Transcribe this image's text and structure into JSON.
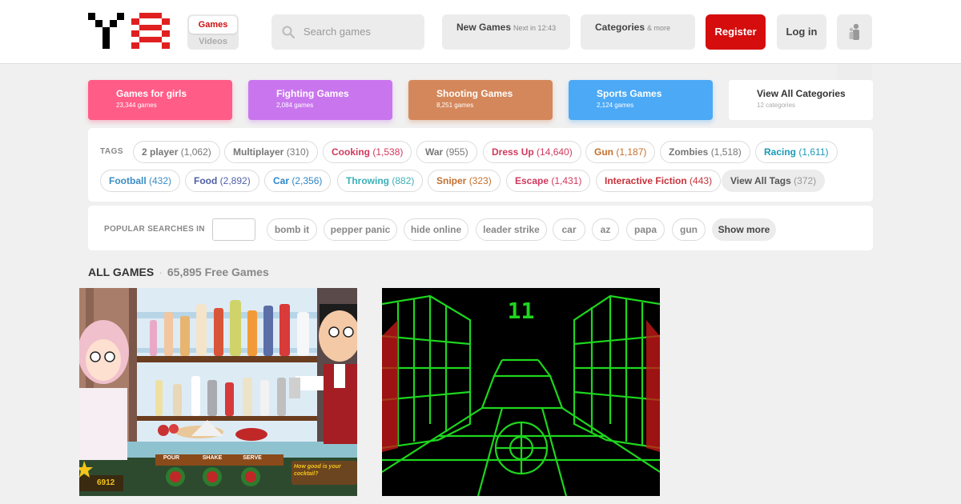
{
  "header": {
    "toggle": {
      "games": "Games",
      "videos": "Videos"
    },
    "search": {
      "placeholder": "Search games"
    },
    "new_games": {
      "label": "New Games",
      "sub": "Next in  12:43"
    },
    "categories": {
      "label": "Categories",
      "sub": "& more"
    },
    "register": "Register",
    "login": "Log in"
  },
  "category_cards": [
    {
      "name": "Games for girls",
      "count": "23,344 games",
      "color": "#ff5c87"
    },
    {
      "name": "Fighting Games",
      "count": "2,084 games",
      "color": "#c976ee"
    },
    {
      "name": "Shooting Games",
      "count": "8,251 games",
      "color": "#d4875a"
    },
    {
      "name": "Sports Games",
      "count": "2,124 games",
      "color": "#4ca9f5"
    },
    {
      "name": "View All Categories",
      "count": "12 categories"
    }
  ],
  "tags": {
    "label": "TAGS",
    "items": [
      {
        "name": "2 player",
        "count": "(1,062)",
        "color": "#777777"
      },
      {
        "name": "Multiplayer",
        "count": "(310)",
        "color": "#777777"
      },
      {
        "name": "Cooking",
        "count": "(1,538)",
        "color": "#d0395d"
      },
      {
        "name": "War",
        "count": "(955)",
        "color": "#777777"
      },
      {
        "name": "Dress Up",
        "count": "(14,640)",
        "color": "#d0395d"
      },
      {
        "name": "Gun",
        "count": "(1,187)",
        "color": "#c3702f"
      },
      {
        "name": "Zombies",
        "count": "(1,518)",
        "color": "#777777"
      },
      {
        "name": "Racing",
        "count": "(1,611)",
        "color": "#1d9ab7"
      },
      {
        "name": "Football",
        "count": "(432)",
        "color": "#3a8dc5"
      },
      {
        "name": "Food",
        "count": "(2,892)",
        "color": "#4d5fa5"
      },
      {
        "name": "Car",
        "count": "(2,356)",
        "color": "#2f86c9"
      },
      {
        "name": "Throwing",
        "count": "(882)",
        "color": "#3ab0b8"
      },
      {
        "name": "Sniper",
        "count": "(323)",
        "color": "#c3702f"
      },
      {
        "name": "Escape",
        "count": "(1,431)",
        "color": "#d0395d"
      },
      {
        "name": "Interactive Fiction",
        "count": "(443)",
        "color": "#c8323a"
      },
      {
        "name": "View All Tags",
        "count": "(372)"
      }
    ]
  },
  "popular": {
    "label": "POPULAR SEARCHES IN",
    "items": [
      "bomb it",
      "pepper panic",
      "hide online",
      "leader strike",
      "car",
      "az",
      "papa",
      "gun"
    ],
    "show_more": "Show more"
  },
  "all_games": {
    "title": "ALL GAMES",
    "dot": "·",
    "count": "65,895 Free Games"
  },
  "game_thumbs": [
    {
      "overlay_score": "6912",
      "overlay_caption": "How good is your cocktail?",
      "buttons": [
        "POUR",
        "SHAKE",
        "SERVE"
      ]
    },
    {
      "overlay_score": "11"
    }
  ]
}
